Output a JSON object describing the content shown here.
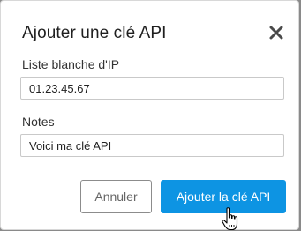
{
  "dialog": {
    "title": "Ajouter une clé API",
    "close_icon": "close-icon"
  },
  "form": {
    "ip_whitelist": {
      "label": "Liste blanche d'IP",
      "value": "01.23.45.67"
    },
    "notes": {
      "label": "Notes",
      "value": "Voici ma clé API"
    }
  },
  "actions": {
    "cancel_label": "Annuler",
    "submit_label": "Ajouter la clé API"
  },
  "colors": {
    "primary": "#0d94e3",
    "cancel_border": "#8c8c8c",
    "cancel_text": "#666666"
  }
}
